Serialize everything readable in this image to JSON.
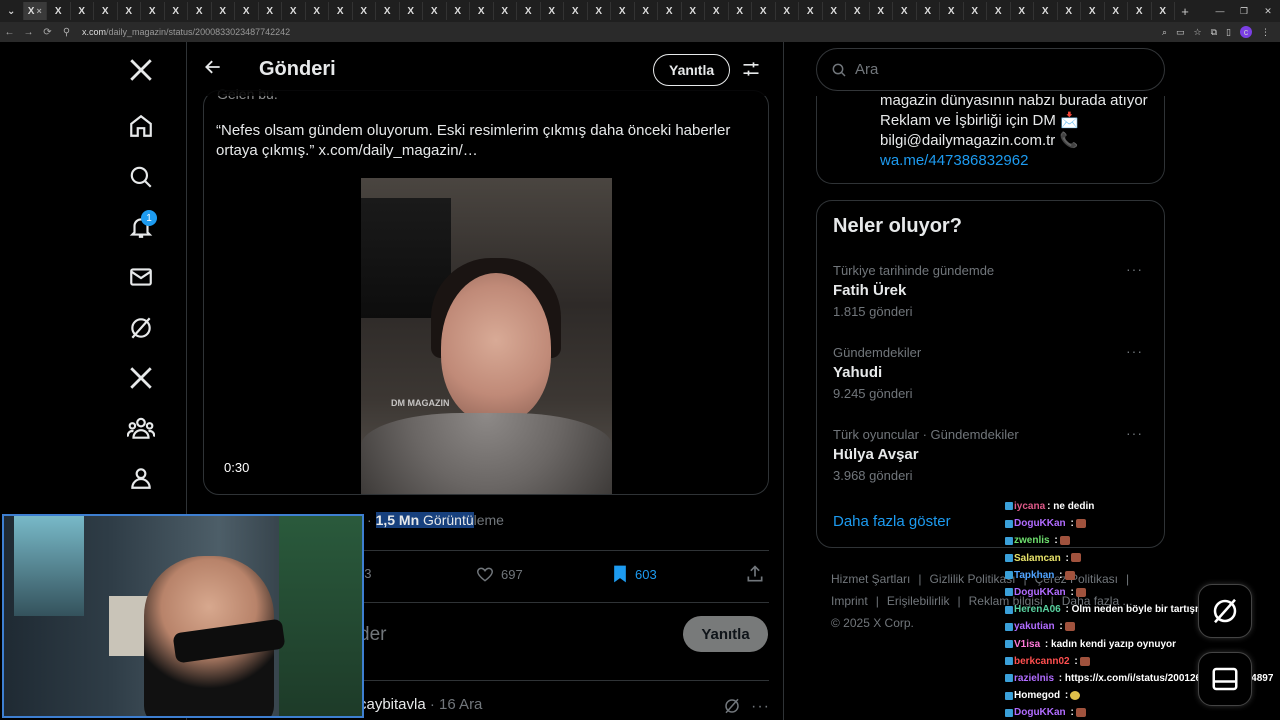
{
  "browser": {
    "tab_glyph": "X",
    "tab_close": "×",
    "tab_count": 49,
    "url_host": "x.com",
    "url_path": "/daily_magazin/status/2000833023487742242"
  },
  "nav": {
    "notification_count": "1"
  },
  "header": {
    "title": "Gönderi",
    "reply_label": "Yanıtla"
  },
  "post": {
    "cut_text": "Gelen bu.",
    "quote_text": "“Nefes olsam gündem oluyorum. Eski resimlerim çıkmış daha önceki haberler ortaya çıkmış.”  x.com/daily_magazin/…",
    "video_duration": "0:30",
    "watermark": "DM MAGAZIN",
    "views_sep": "· ",
    "views_count": "1,5 Mn",
    "views_label_hl": " Görüntü",
    "views_label_rest": "leme",
    "repost_count": "53",
    "like_count": "697",
    "bookmark_count": "603"
  },
  "reply_box": {
    "placeholder_tail": "der",
    "button": "Yanıtla"
  },
  "next_post": {
    "handle": "caybitavla",
    "date": " · 16 Ara",
    "more": "···"
  },
  "search": {
    "placeholder": "Ara"
  },
  "bio": {
    "line1": "magazin dünyasının nabzı burada atıyor Reklam ve İşbirliği için DM 📩 bilgi@dailymagazin.com.tr 📞",
    "link": "wa.me/447386832962"
  },
  "trends": {
    "title": "Neler oluyor?",
    "items": [
      {
        "context": "Türkiye tarihinde gündemde",
        "topic": "Fatih Ürek",
        "count": "1.815 gönderi"
      },
      {
        "context": "Gündemdekiler",
        "topic": "Yahudi",
        "count": "9.245 gönderi"
      },
      {
        "context": "Türk oyuncular · Gündemdekiler",
        "topic": "Hülya Avşar",
        "count": "3.968 gönderi"
      }
    ],
    "more_dots": "···",
    "show_more": "Daha fazla göster"
  },
  "footer": {
    "links": [
      "Hizmet Şartları",
      "|",
      "Gizlilik Politikası",
      "|",
      "Çerez Politikası",
      "|",
      "Imprint",
      "|",
      "Erişilebilirlik",
      "|",
      "Reklam bilgisi",
      "|",
      "Daha fazla ..."
    ],
    "copyright": "© 2025 X Corp."
  },
  "chat": {
    "messages": [
      {
        "user": "iycana",
        "text": ": ne dedin",
        "color": "#e05a8a",
        "emote": ""
      },
      {
        "user": "DoguKKan",
        "text": " :",
        "color": "#b16cff",
        "emote": "block"
      },
      {
        "user": "zwenlis",
        "text": " :",
        "color": "#6ee06e",
        "emote": "block"
      },
      {
        "user": "Salamcan",
        "text": " :",
        "color": "#e8e36a",
        "emote": "block"
      },
      {
        "user": "Tapkhan",
        "text": " :",
        "color": "#4fa3ff",
        "emote": "block"
      },
      {
        "user": "DoguKKan",
        "text": " :",
        "color": "#b16cff",
        "emote": "block"
      },
      {
        "user": "HerenA06",
        "text": " : Olm neden böyle bir tartışma var aq",
        "color": "#59d2a0",
        "emote": ""
      },
      {
        "user": "yakutian",
        "text": " :",
        "color": "#b16cff",
        "emote": "block"
      },
      {
        "user": "V1isa",
        "text": " : kadın kendi yazıp oynuyor",
        "color": "#ff7ad9",
        "emote": ""
      },
      {
        "user": "berkcann02",
        "text": " :",
        "color": "#ff4f4f",
        "emote": "block"
      },
      {
        "user": "razielnis",
        "text": " : https://x.com/i/status/2001261322367324897",
        "color": "#b16cff",
        "emote": ""
      },
      {
        "user": "Homegod",
        "text": " :",
        "color": "#ffffff",
        "emote": "y"
      },
      {
        "user": "DoguKKan",
        "text": " :",
        "color": "#b16cff",
        "emote": "block"
      }
    ]
  },
  "colors": {
    "accent": "#1d9bf0",
    "background": "#000000",
    "muted": "#71767b",
    "selection": "#17407d",
    "webcam_border": "#3e7fd1"
  }
}
